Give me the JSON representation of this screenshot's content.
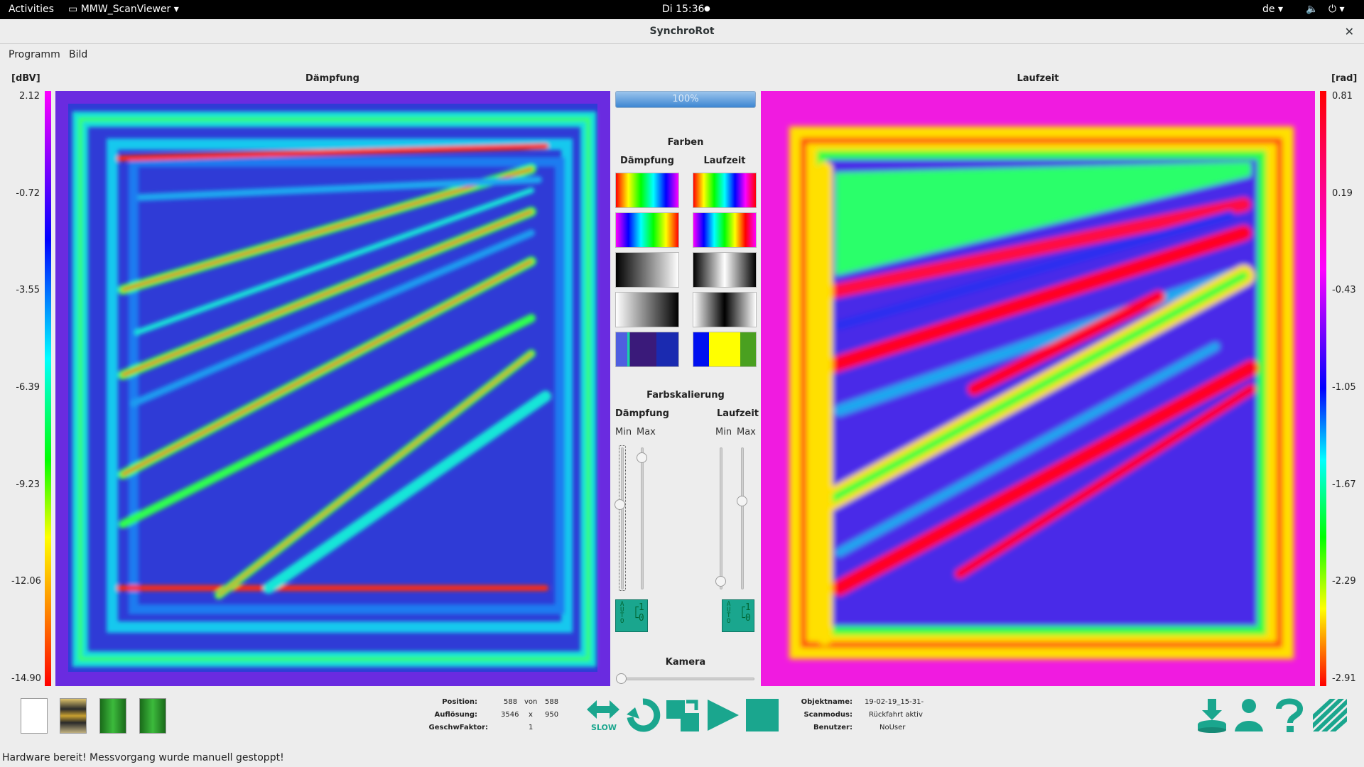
{
  "topbar": {
    "activities": "Activities",
    "app_name": "MMW_ScanViewer",
    "clock": "Di 15:36",
    "lang": "de"
  },
  "window": {
    "title": "SynchroRot"
  },
  "menu": [
    "Programm",
    "Bild"
  ],
  "left_panel": {
    "unit": "[dBV]",
    "title": "Dämpfung",
    "ticks": [
      "2.12",
      "-0.72",
      "-3.55",
      "-6.39",
      "-9.23",
      "-12.06",
      "-14.90"
    ]
  },
  "right_panel": {
    "unit": "[rad]",
    "title": "Laufzeit",
    "ticks": [
      "0.81",
      "0.19",
      "-0.43",
      "-1.05",
      "-1.67",
      "-2.29",
      "-2.91"
    ]
  },
  "progress": {
    "label": "100%",
    "value": 1.0
  },
  "colors": {
    "title": "Farben",
    "col_left": "Dämpfung",
    "col_right": "Laufzeit",
    "scale_title": "Farbskalierung",
    "scale_left": "Dämpfung",
    "scale_right": "Laufzeit",
    "min": "Min",
    "max": "Max",
    "accent": "#1aa68e",
    "camera": "Kamera"
  },
  "info": {
    "position_label": "Position:",
    "position_value": "588",
    "von": "von",
    "position_total": "588",
    "resolution_label": "Auflösung:",
    "res_x": "3546",
    "x": "x",
    "res_y": "950",
    "speed_label": "GeschwFaktor:",
    "speed_value": "1",
    "object_label": "Objektname:",
    "object_value": "19-02-19_15-31-",
    "scanmode_label": "Scanmodus:",
    "scanmode_value": "Rückfahrt aktiv",
    "user_label": "Benutzer:",
    "user_value": "NoUser"
  },
  "toolbar": {
    "slow": "SLOW",
    "auto": "AUTO"
  },
  "status": "Hardware bereit!  Messvorgang wurde manuell gestoppt!"
}
